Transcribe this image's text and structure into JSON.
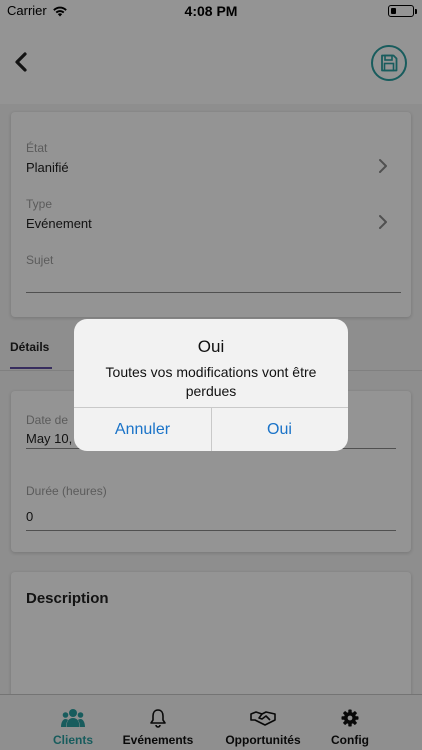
{
  "status_bar": {
    "carrier": "Carrier",
    "time": "4:08 PM"
  },
  "form": {
    "etat": {
      "label": "État",
      "value": "Planifié"
    },
    "type": {
      "label": "Type",
      "value": "Evénement"
    },
    "sujet": {
      "label": "Sujet",
      "value": ""
    }
  },
  "tabs": {
    "active": "Détails"
  },
  "details": {
    "date": {
      "label": "Date de",
      "value": "May 10,"
    },
    "duree": {
      "label": "Durée (heures)",
      "value": "0"
    }
  },
  "description": {
    "title": "Description"
  },
  "tab_bar": [
    {
      "label": "Clients",
      "icon": "users-icon",
      "active": true
    },
    {
      "label": "Evénements",
      "icon": "bell-icon",
      "active": false
    },
    {
      "label": "Opportunités",
      "icon": "handshake-icon",
      "active": false
    },
    {
      "label": "Config",
      "icon": "gear-icon",
      "active": false
    }
  ],
  "alert": {
    "title": "Oui",
    "message": "Toutes vos modifications vont être perdues",
    "cancel_label": "Annuler",
    "confirm_label": "Oui"
  },
  "colors": {
    "accent": "#2a9fa1",
    "active_tab": "#2a9fa1",
    "tab_indicator": "#5f4ea3",
    "alert_button": "#1a73c8"
  }
}
